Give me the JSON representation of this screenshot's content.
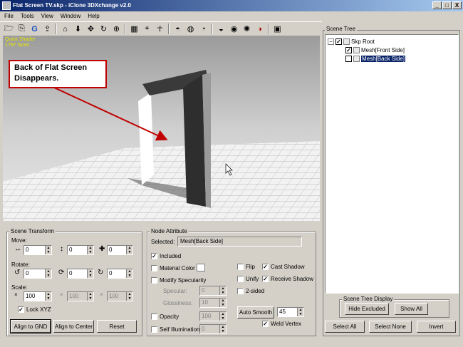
{
  "window": {
    "title": "Flat Screen TV.skp - iClone 3DXchange v2.0",
    "controls": [
      "_",
      "□",
      "X"
    ]
  },
  "menu": [
    "File",
    "Tools",
    "View",
    "Window",
    "Help"
  ],
  "viewport": {
    "info_line1": "Quick Shader",
    "info_line2": "1797 faces",
    "callout": "Back of Flat Screen Disappears."
  },
  "scene_tree": {
    "title": "Scene Tree",
    "root": "Skp Root",
    "nodes": [
      "Mesh[Front Side]",
      "Mesh[Back Side]"
    ],
    "root_checked": true,
    "front_checked": true,
    "back_checked": false
  },
  "scene_tree_display": {
    "title": "Scene Tree Display",
    "hide_excluded": "Hide Excluded",
    "show_all": "Show All"
  },
  "tree_buttons": {
    "select_all": "Select All",
    "select_none": "Select None",
    "invert": "Invert"
  },
  "scene_transform": {
    "title": "Scene Transform",
    "move_label": "Move:",
    "move": [
      "0",
      "0",
      "0"
    ],
    "rotate_label": "Rotate:",
    "rotate": [
      "0",
      "0",
      "0"
    ],
    "scale_label": "Scale:",
    "scale": [
      "100",
      "100",
      "100"
    ],
    "lock_xyz": "Lock XYZ",
    "lock_checked": true,
    "align_gnd": "Align to GND",
    "align_center": "Align to Center",
    "reset": "Reset"
  },
  "node_attribute": {
    "title": "Node Attribute",
    "selected_label": "Selected:",
    "selected_value": "Mesh[Back Side]",
    "included": "Included",
    "included_checked": true,
    "material_color": "Material Color",
    "modify_specularity": "Modify Specularity",
    "specular": "Specular:",
    "specular_value": "0",
    "glossiness": "Glossiness:",
    "glossiness_value": "10",
    "opacity": "Opacity",
    "opacity_value": "100",
    "self_illumination": "Self Illumination",
    "self_illumination_value": "0",
    "flip": "Flip",
    "unify": "Unify",
    "two_sided": "2-sided",
    "cast_shadow": "Cast Shadow",
    "cast_shadow_checked": true,
    "receive_shadow": "Receive Shadow",
    "receive_shadow_checked": true,
    "auto_smooth": "Auto Smooth",
    "auto_smooth_value": "45",
    "weld_vertex": "Weld Vertex",
    "weld_vertex_checked": true
  },
  "colors": {
    "title_start": "#0a246a",
    "title_end": "#a6caf0",
    "callout_border": "#c00000",
    "arrow": "#c00000",
    "viewport_info": "#e8e800"
  },
  "toolbar_icons": [
    "open-icon",
    "import-icon",
    "g-icon",
    "export-icon",
    "home-icon",
    "down-arrow-icon",
    "move-icon",
    "rotate-icon",
    "pivot-icon",
    "grid-icon",
    "pick-icon",
    "person-icon",
    "sphere-icon",
    "globe-icon",
    "camera-icon",
    "shader-icon",
    "bake-icon",
    "light-icon",
    "color-icon",
    "save-icon"
  ]
}
